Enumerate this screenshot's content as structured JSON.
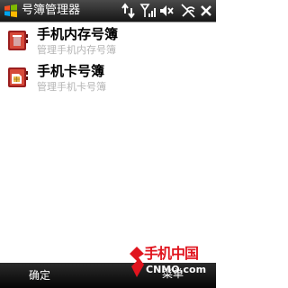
{
  "colors": {
    "statusbar": "#2a2a2a",
    "softbar": "#111111",
    "subtitle": "#b4b4b4",
    "watermark_red": "#e0141e"
  },
  "statusbar": {
    "title": "号簿管理器",
    "icons": [
      "windows-logo-icon",
      "sync-arrows-icon",
      "signal-strength-icon",
      "volume-muted-icon",
      "connectivity-off-icon"
    ]
  },
  "list": {
    "items": [
      {
        "title": "手机内存号簿",
        "subtitle": "管理手机内存号簿",
        "icon": "phone-memory-contacts-icon"
      },
      {
        "title": "手机卡号簿",
        "subtitle": "管理手机卡号簿",
        "icon": "sim-card-contacts-icon"
      }
    ]
  },
  "softkeys": {
    "left": "确定",
    "right": "菜单"
  },
  "watermark": {
    "cn": "手机中国",
    "en": "CNMO.com"
  }
}
